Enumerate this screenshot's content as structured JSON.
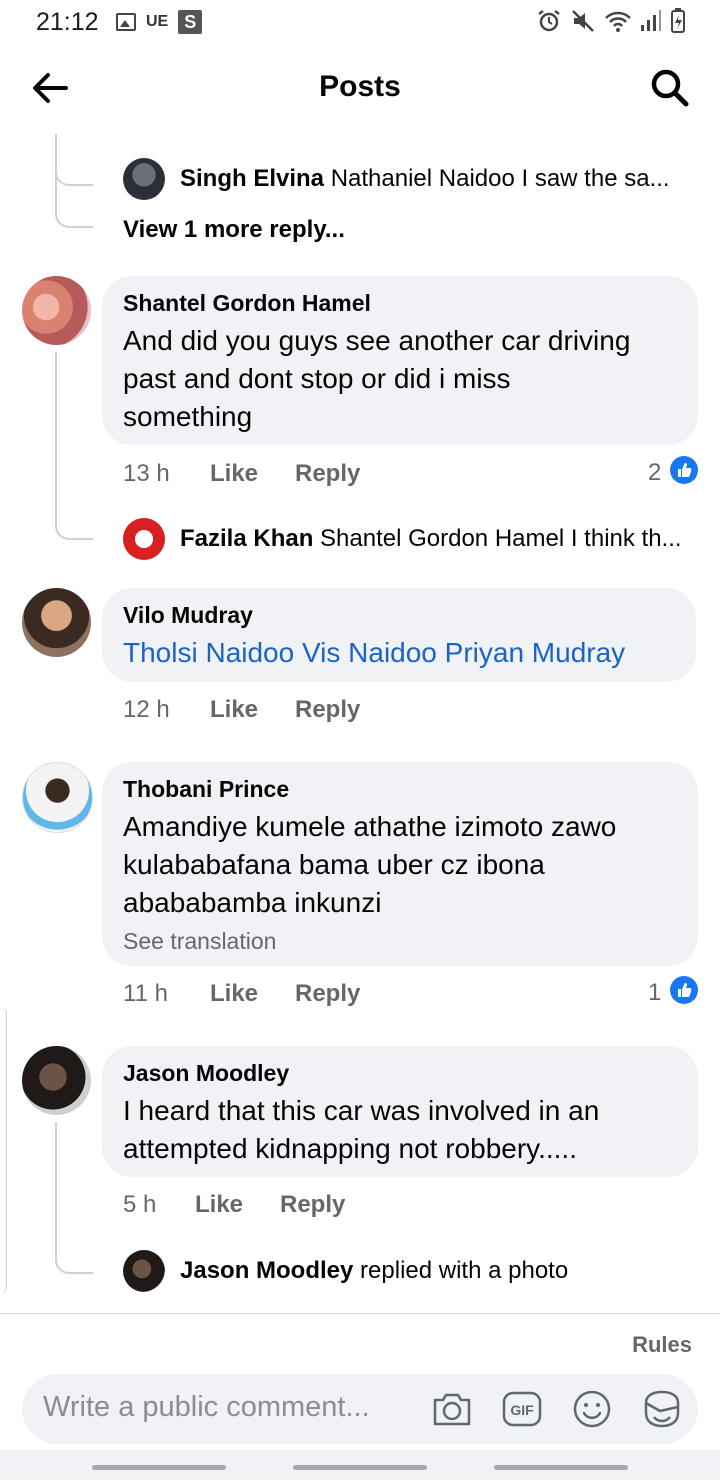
{
  "status_bar": {
    "time": "21:12",
    "carrier_text": "UE",
    "app_badge": "S"
  },
  "header": {
    "title": "Posts"
  },
  "thread0": {
    "reply": {
      "name": "Singh Elvina",
      "text": "Nathaniel Naidoo I saw the sa..."
    },
    "view_more": "View 1 more reply..."
  },
  "comments": [
    {
      "name": "Shantel Gordon Hamel",
      "lines": [
        "And did you guys see another car driving",
        "past and dont stop or did i miss",
        "something"
      ],
      "time": "13 h",
      "like": "Like",
      "reply": "Reply",
      "reaction_count": "2",
      "reply_preview": {
        "name": "Fazila Khan",
        "text": "Shantel Gordon Hamel I think th..."
      }
    },
    {
      "name": "Vilo Mudray",
      "link_text": "Tholsi Naidoo Vis Naidoo Priyan Mudray",
      "time": "12 h",
      "like": "Like",
      "reply": "Reply"
    },
    {
      "name": "Thobani Prince",
      "lines": [
        "Amandiye kumele athathe izimoto zawo",
        "kulababafana bama uber cz ibona",
        "abababamba inkunzi"
      ],
      "see_translation": "See translation",
      "time": "11 h",
      "like": "Like",
      "reply": "Reply",
      "reaction_count": "1"
    },
    {
      "name": "Jason Moodley",
      "lines": [
        "I heard that this car was involved in an",
        "attempted kidnapping not robbery....."
      ],
      "time": "5 h",
      "like": "Like",
      "reply": "Reply",
      "reply_preview": {
        "name": "Jason Moodley",
        "text": "replied with a photo"
      }
    }
  ],
  "footer": {
    "rules": "Rules",
    "composer_placeholder": "Write a public comment..."
  },
  "colors": {
    "accent": "#1877f2",
    "link": "#1a63c9",
    "bubble": "#f0f2f5",
    "meta": "#65676b"
  }
}
